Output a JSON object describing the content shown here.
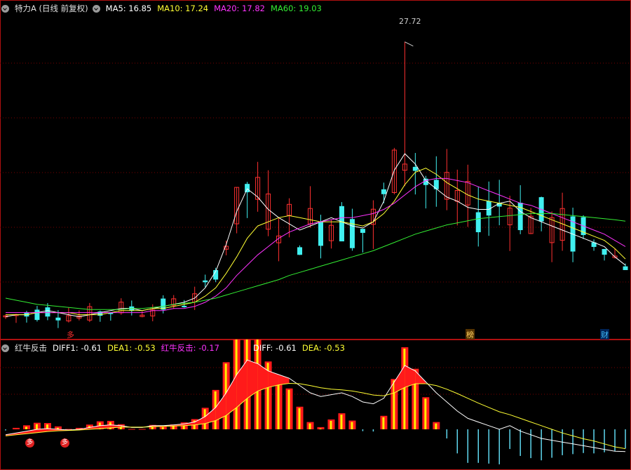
{
  "main_header": {
    "title": "特力A (日线 前复权)",
    "ma5_label": "MA5: 16.85",
    "ma10_label": "MA10: 17.24",
    "ma20_label": "MA20: 17.82",
    "ma60_label": "MA60: 19.03"
  },
  "peak_label": "27.72",
  "event_tags": [
    "多",
    "榜",
    "财"
  ],
  "sub_header": {
    "name": "红牛反击",
    "diff1_label": "DIFF1: -0.61",
    "dea1_label": "DEA1: -0.53",
    "hnfj_label": "红牛反击: -0.17",
    "diff_label": "DIFF: -0.61",
    "dea_label": "DEA: -0.53"
  },
  "signal_markers": [
    "多",
    "多"
  ],
  "colors": {
    "up": "#ff3030",
    "down": "#40f0f0",
    "ma5": "#ffffff",
    "ma10": "#ffff33",
    "ma20": "#ff33ff",
    "ma60": "#33ee33",
    "border": "#b01010",
    "grid": "#7a0000"
  },
  "chart_data": {
    "type": "candlestick",
    "series": [
      {
        "name": "MA5",
        "values": [
          14.4,
          14.5,
          14.5,
          14.6,
          14.7,
          14.6,
          14.5,
          14.4,
          14.5,
          14.6,
          14.7,
          14.8,
          14.8,
          14.7,
          14.8,
          14.9,
          15.0,
          15.1,
          15.3,
          15.8,
          16.6,
          17.9,
          19.5,
          20.6,
          20.2,
          19.6,
          19.2,
          18.9,
          18.6,
          18.8,
          19.0,
          19.2,
          19.0,
          18.8,
          18.7,
          19.0,
          20.0,
          21.5,
          22.3,
          21.8,
          21.0,
          20.6,
          20.2,
          20.0,
          19.7,
          19.6,
          19.6,
          19.9,
          20.0,
          19.5,
          19.2,
          19.0,
          18.8,
          18.6,
          18.4,
          18.2,
          18.0,
          17.8,
          17.3,
          16.9
        ]
      },
      {
        "name": "MA10",
        "values": [
          14.5,
          14.5,
          14.5,
          14.6,
          14.6,
          14.6,
          14.6,
          14.5,
          14.5,
          14.5,
          14.6,
          14.7,
          14.7,
          14.7,
          14.8,
          14.8,
          14.9,
          15.0,
          15.1,
          15.4,
          15.8,
          16.5,
          17.3,
          18.2,
          18.8,
          19.0,
          19.2,
          19.3,
          19.2,
          19.1,
          19.0,
          19.0,
          19.0,
          18.9,
          18.8,
          19.0,
          19.4,
          20.0,
          20.8,
          21.4,
          21.6,
          21.3,
          20.9,
          20.6,
          20.3,
          20.1,
          20.0,
          19.9,
          19.8,
          19.7,
          19.5,
          19.3,
          19.1,
          18.9,
          18.7,
          18.5,
          18.3,
          18.1,
          17.7,
          17.2
        ]
      },
      {
        "name": "MA20",
        "values": [
          14.6,
          14.6,
          14.6,
          14.6,
          14.6,
          14.6,
          14.6,
          14.6,
          14.6,
          14.6,
          14.6,
          14.6,
          14.6,
          14.6,
          14.7,
          14.7,
          14.8,
          14.8,
          14.9,
          15.1,
          15.4,
          15.8,
          16.4,
          16.9,
          17.4,
          17.8,
          18.2,
          18.5,
          18.7,
          18.9,
          19.0,
          19.1,
          19.2,
          19.2,
          19.3,
          19.4,
          19.6,
          19.9,
          20.3,
          20.7,
          21.0,
          21.1,
          21.1,
          21.0,
          20.9,
          20.7,
          20.5,
          20.3,
          20.1,
          19.9,
          19.8,
          19.6,
          19.4,
          19.2,
          19.0,
          18.8,
          18.6,
          18.4,
          18.1,
          17.8
        ]
      },
      {
        "name": "MA60",
        "values": [
          15.3,
          15.2,
          15.1,
          15.0,
          14.95,
          14.9,
          14.85,
          14.8,
          14.75,
          14.75,
          14.75,
          14.75,
          14.8,
          14.8,
          14.85,
          14.9,
          15.0,
          15.05,
          15.1,
          15.2,
          15.3,
          15.45,
          15.6,
          15.75,
          15.9,
          16.05,
          16.2,
          16.4,
          16.55,
          16.7,
          16.85,
          17.0,
          17.15,
          17.3,
          17.45,
          17.6,
          17.8,
          18.0,
          18.2,
          18.4,
          18.55,
          18.7,
          18.85,
          18.95,
          19.05,
          19.15,
          19.2,
          19.25,
          19.3,
          19.35,
          19.4,
          19.4,
          19.4,
          19.35,
          19.3,
          19.25,
          19.2,
          19.15,
          19.1,
          19.03
        ]
      }
    ],
    "peak": 27.72,
    "ylim": [
      13.5,
      29.0
    ],
    "subchart": {
      "series": [
        "DIFF1",
        "DEA1",
        "红牛反击",
        "DIFF",
        "DEA"
      ],
      "latest": {
        "DIFF1": -0.61,
        "DEA1": -0.53,
        "红牛反击": -0.17,
        "DIFF": -0.61,
        "DEA": -0.53
      },
      "diff": [
        -0.15,
        -0.1,
        -0.05,
        0.0,
        0.02,
        0.0,
        -0.02,
        0.0,
        0.05,
        0.1,
        0.12,
        0.1,
        0.05,
        0.05,
        0.1,
        0.1,
        0.12,
        0.15,
        0.2,
        0.35,
        0.6,
        1.0,
        1.5,
        1.9,
        1.8,
        1.6,
        1.5,
        1.4,
        1.2,
        1.0,
        0.9,
        0.95,
        1.0,
        0.9,
        0.75,
        0.7,
        0.85,
        1.3,
        1.75,
        1.6,
        1.3,
        1.0,
        0.75,
        0.5,
        0.3,
        0.2,
        0.1,
        0.0,
        0.1,
        -0.05,
        -0.15,
        -0.25,
        -0.3,
        -0.35,
        -0.4,
        -0.45,
        -0.5,
        -0.55,
        -0.6,
        -0.61
      ],
      "dea": [
        -0.18,
        -0.15,
        -0.12,
        -0.09,
        -0.06,
        -0.04,
        -0.03,
        -0.02,
        0.0,
        0.02,
        0.04,
        0.06,
        0.06,
        0.06,
        0.07,
        0.08,
        0.09,
        0.1,
        0.12,
        0.16,
        0.24,
        0.38,
        0.6,
        0.85,
        1.05,
        1.15,
        1.22,
        1.26,
        1.25,
        1.2,
        1.14,
        1.1,
        1.08,
        1.05,
        1.0,
        0.94,
        0.92,
        1.0,
        1.15,
        1.25,
        1.25,
        1.2,
        1.1,
        0.98,
        0.85,
        0.72,
        0.6,
        0.48,
        0.4,
        0.3,
        0.2,
        0.1,
        0.0,
        -0.1,
        -0.18,
        -0.26,
        -0.32,
        -0.4,
        -0.48,
        -0.53
      ],
      "ylim": [
        -1.0,
        2.0
      ]
    }
  }
}
